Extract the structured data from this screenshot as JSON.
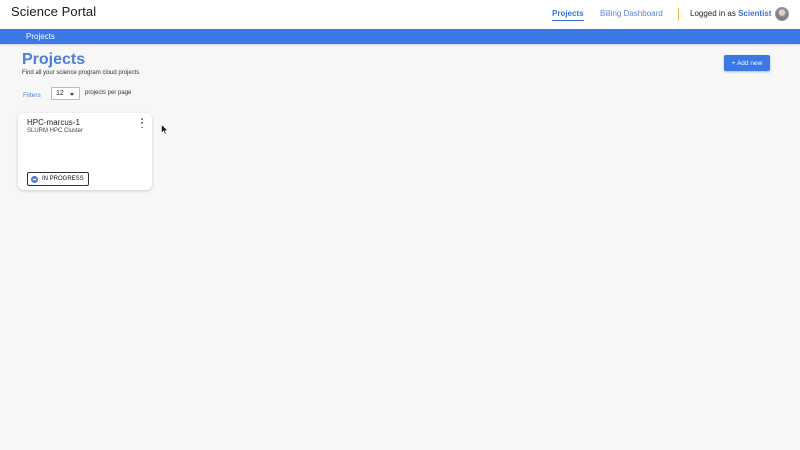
{
  "header": {
    "app_title": "Science Portal",
    "nav": [
      {
        "label": "Projects",
        "active": true
      },
      {
        "label": "Billing Dashboard",
        "active": false
      }
    ],
    "login_prefix": "Logged in as",
    "login_user": "Scientist",
    "avatar_icon": "user-avatar"
  },
  "subbar": {
    "breadcrumb": "Projects"
  },
  "page": {
    "title": "Projects",
    "subtitle": "Find all your science program cloud projects",
    "add_button_label": "+ Add new"
  },
  "filters": {
    "filters_label": "Filters",
    "per_page_value": "12",
    "per_page_label": "projects per page"
  },
  "projects": [
    {
      "name": "HPC-marcus-1",
      "type": "SLURM HPC Cluster",
      "status": "IN PROGRESS",
      "menu_icon": "kebab-menu-icon",
      "status_icon": "progress-icon"
    }
  ],
  "colors": {
    "accent": "#3b78e7",
    "link": "#4a7fd9",
    "divider": "#e8c34a",
    "background": "#f7f7f8"
  }
}
